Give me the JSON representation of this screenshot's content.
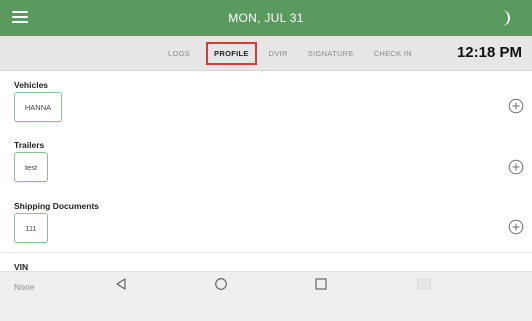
{
  "header": {
    "date": "MON, JUL 31",
    "menu_icon": "hamburger-menu-icon",
    "theme_icon": "moon-icon",
    "bar_color": "#5b9a5e"
  },
  "tabs": [
    {
      "label": "LOGS",
      "active": false
    },
    {
      "label": "PROFILE",
      "active": true
    },
    {
      "label": "DVIR",
      "active": false
    },
    {
      "label": "SIGNATURE",
      "active": false
    },
    {
      "label": "CHECK IN",
      "active": false
    }
  ],
  "clock": "12:18 PM",
  "accent_color": "#d83a3a",
  "sections": {
    "vehicles": {
      "label": "Vehicles",
      "item": "HANNA",
      "add_icon": "add-circle-icon"
    },
    "trailers": {
      "label": "Trailers",
      "item": "test",
      "add_icon": "add-circle-icon"
    },
    "shipping": {
      "label": "Shipping Documents",
      "item": "111",
      "add_icon": "add-circle-icon"
    },
    "vin": {
      "label": "VIN",
      "value": "None"
    }
  },
  "nav": {
    "back_icon": "back-triangle-icon",
    "home_icon": "home-circle-icon",
    "recents_icon": "recents-square-icon",
    "extra_icon": "keyboard-icon"
  }
}
